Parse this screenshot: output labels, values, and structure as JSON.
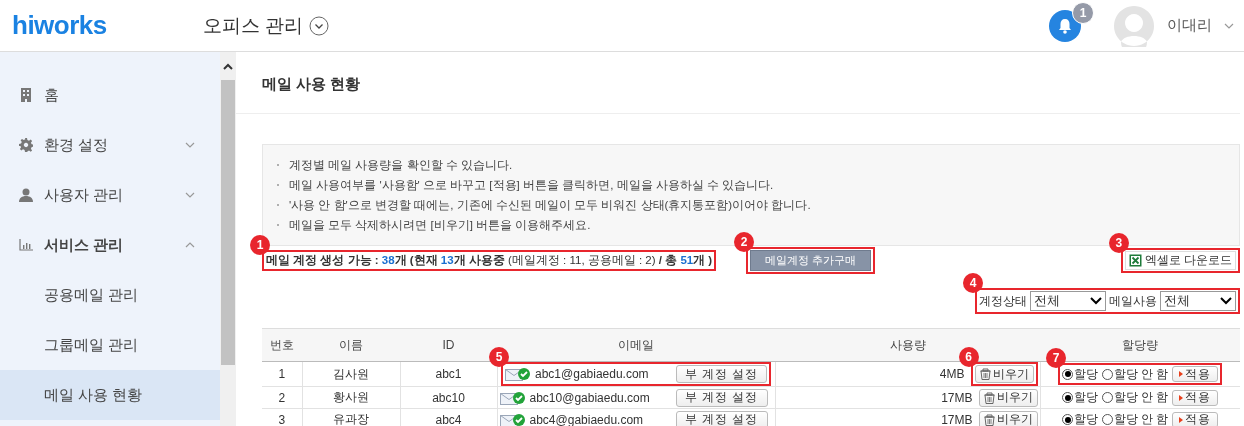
{
  "header": {
    "logo": "hiworks",
    "app_menu": "오피스 관리",
    "notifications": {
      "count": "1"
    },
    "user": {
      "name": "이대리"
    }
  },
  "sidebar": {
    "items": [
      {
        "label": "홈",
        "selected": false
      },
      {
        "label": "환경 설정",
        "expanded": false,
        "selected": false
      },
      {
        "label": "사용자 관리",
        "expanded": false,
        "selected": false
      },
      {
        "label": "서비스 관리",
        "expanded": true,
        "selected": false,
        "children": [
          {
            "label": "공용메일 관리",
            "selected": false
          },
          {
            "label": "그룹메일 관리",
            "selected": false
          },
          {
            "label": "메일 사용 현황",
            "selected": true
          }
        ]
      }
    ]
  },
  "page": {
    "title": "메일 사용 현황",
    "notices": [
      "계정별 메일 사용량을 확인할 수 있습니다.",
      "메일 사용여부를 '사용함' 으로 바꾸고 [적용] 버튼을 클릭하면, 메일을 사용하실 수 있습니다.",
      "'사용 안 함'으로 변경할 때에는, 기존에 수신된 메일이 모두 비워진 상태(휴지통포함)이어야 합니다.",
      "메일을 모두 삭제하시려면 [비우기] 버튼을 이용해주세요."
    ],
    "summary": {
      "marker": "1",
      "parts": [
        {
          "kind": "label",
          "text": "메일 계정 생성 가능 : "
        },
        {
          "kind": "number",
          "text": "38"
        },
        {
          "kind": "label",
          "text": "개 (현재 "
        },
        {
          "kind": "number",
          "text": "13"
        },
        {
          "kind": "label",
          "text": "개 사용중 "
        },
        {
          "kind": "plain",
          "text": "(메일계정 : 11, 공용메일 : 2)"
        },
        {
          "kind": "label",
          "text": " / 총 "
        },
        {
          "kind": "number",
          "text": "51"
        },
        {
          "kind": "label",
          "text": "개 )"
        }
      ]
    },
    "buy_button": {
      "label": "메일계정 추가구매",
      "marker": "2"
    },
    "excel_button": {
      "label": "엑셀로 다운로드",
      "marker": "3"
    },
    "filters": {
      "marker": "4",
      "items": [
        {
          "label": "계정상태",
          "value": "전체"
        },
        {
          "label": "메일사용",
          "value": "전체"
        }
      ]
    },
    "table": {
      "columns": [
        "번호",
        "이름",
        "ID",
        "이메일",
        "사용량",
        "할당량"
      ],
      "rows": [
        {
          "no": "1",
          "name": "김사원",
          "id": "abc1",
          "email": "abc1@gabiaedu.com",
          "sub_button": "부 계정 설정",
          "usage": "4MB",
          "empty_button": "비우기",
          "options": [
            {
              "label": "할당",
              "selected": true
            },
            {
              "label": "할당 안 함",
              "selected": false
            }
          ],
          "apply_button": "적용",
          "email_marker": "5",
          "empty_marker": "6",
          "quota_marker": "7"
        },
        {
          "no": "2",
          "name": "황사원",
          "id": "abc10",
          "email": "abc10@gabiaedu.com",
          "sub_button": "부 계정 설정",
          "usage": "17MB",
          "empty_button": "비우기",
          "options": [
            {
              "label": "할당",
              "selected": true
            },
            {
              "label": "할당 안 함",
              "selected": false
            }
          ],
          "apply_button": "적용"
        },
        {
          "no": "3",
          "name": "유과장",
          "id": "abc4",
          "email": "abc4@gabiaedu.com",
          "sub_button": "부 계정 설정",
          "usage": "17MB",
          "empty_button": "비우기",
          "options": [
            {
              "label": "할당",
              "selected": true
            },
            {
              "label": "할당 안 함",
              "selected": false
            }
          ],
          "apply_button": "적용"
        }
      ]
    }
  }
}
